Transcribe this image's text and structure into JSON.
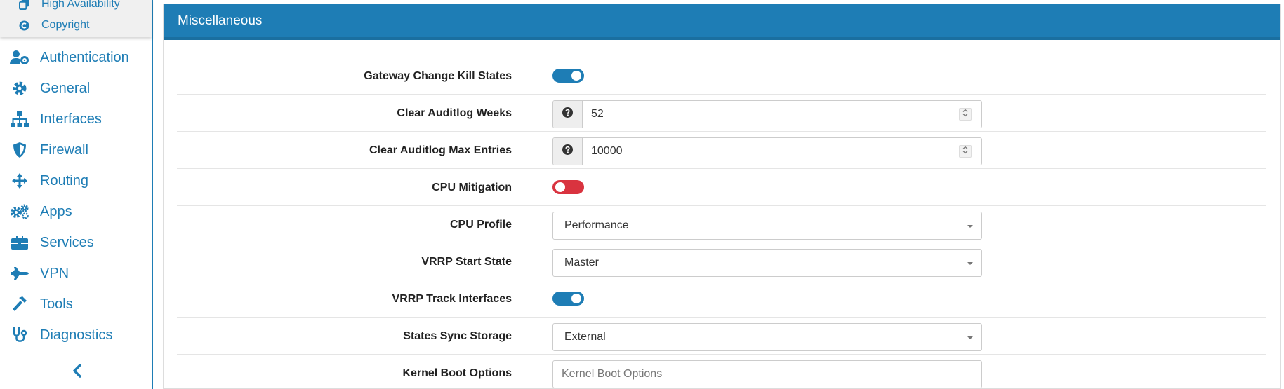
{
  "sidebar": {
    "submenu": [
      {
        "label": "High Availability",
        "icon": "copy-icon"
      },
      {
        "label": "Copyright",
        "icon": "copyright-icon"
      }
    ],
    "items": [
      {
        "label": "Authentication",
        "icon": "user-cog-icon"
      },
      {
        "label": "General",
        "icon": "gear-icon"
      },
      {
        "label": "Interfaces",
        "icon": "sitemap-icon"
      },
      {
        "label": "Firewall",
        "icon": "shield-icon"
      },
      {
        "label": "Routing",
        "icon": "arrows-icon"
      },
      {
        "label": "Apps",
        "icon": "gears-icon"
      },
      {
        "label": "Services",
        "icon": "toolbox-icon"
      },
      {
        "label": "VPN",
        "icon": "plane-icon"
      },
      {
        "label": "Tools",
        "icon": "hammer-icon"
      },
      {
        "label": "Diagnostics",
        "icon": "stethoscope-icon"
      }
    ],
    "collapse_icon": "chevron-left-icon"
  },
  "panel": {
    "title": "Miscellaneous"
  },
  "settings": {
    "gateway_change_kill_states": {
      "label": "Gateway Change Kill States",
      "enabled": true
    },
    "clear_auditlog_weeks": {
      "label": "Clear Auditlog Weeks",
      "value": "52"
    },
    "clear_auditlog_max_entries": {
      "label": "Clear Auditlog Max Entries",
      "value": "10000"
    },
    "cpu_mitigation": {
      "label": "CPU Mitigation",
      "enabled": false
    },
    "cpu_profile": {
      "label": "CPU Profile",
      "value": "Performance"
    },
    "vrrp_start_state": {
      "label": "VRRP Start State",
      "value": "Master"
    },
    "vrrp_track_interfaces": {
      "label": "VRRP Track Interfaces",
      "enabled": true
    },
    "states_sync_storage": {
      "label": "States Sync Storage",
      "value": "External"
    },
    "kernel_boot_options": {
      "label": "Kernel Boot Options",
      "placeholder": "Kernel Boot Options"
    }
  },
  "colors": {
    "accent": "#1e7db5",
    "toggle_on": "#1e7db5",
    "toggle_off": "#d9333f"
  }
}
